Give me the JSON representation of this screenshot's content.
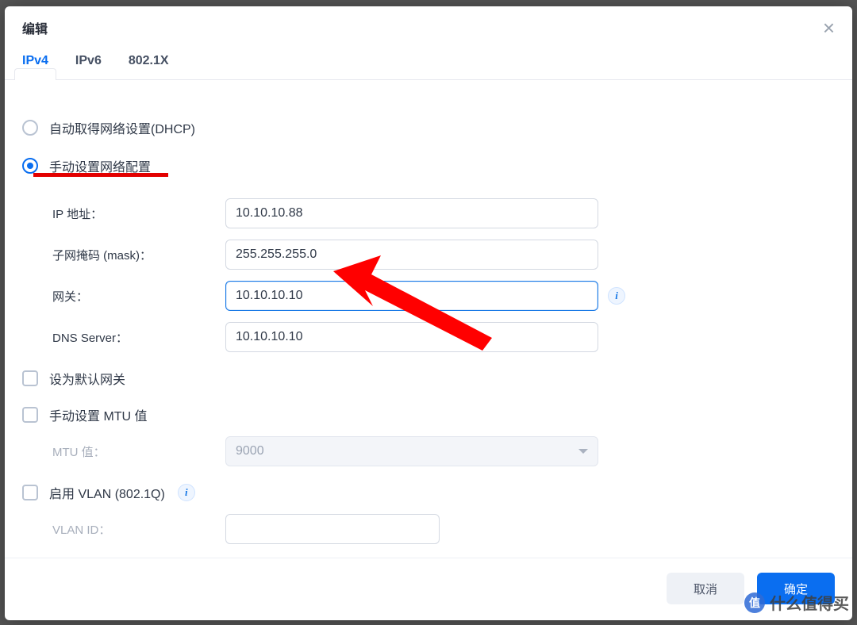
{
  "dialog": {
    "title": "编辑"
  },
  "tabs": {
    "ipv4": "IPv4",
    "ipv6": "IPv6",
    "dot1x": "802.1X"
  },
  "radio": {
    "dhcp": "自动取得网络设置(DHCP)",
    "manual": "手动设置网络配置"
  },
  "fields": {
    "ip_label": "IP 地址：",
    "ip_value": "10.10.10.88",
    "mask_label": "子网掩码 (mask)：",
    "mask_value": "255.255.255.0",
    "gateway_label": "网关：",
    "gateway_value": "10.10.10.10",
    "dns_label": "DNS Server：",
    "dns_value": "10.10.10.10",
    "mtu_label": "MTU 值：",
    "mtu_value": "9000",
    "vlan_id_label": "VLAN ID："
  },
  "checkboxes": {
    "default_gateway": "设为默认网关",
    "manual_mtu": "手动设置 MTU 值",
    "enable_vlan": "启用 VLAN (802.1Q)"
  },
  "buttons": {
    "cancel": "取消",
    "ok": "确定"
  },
  "watermark": {
    "logo": "值",
    "text": "什么值得买"
  }
}
